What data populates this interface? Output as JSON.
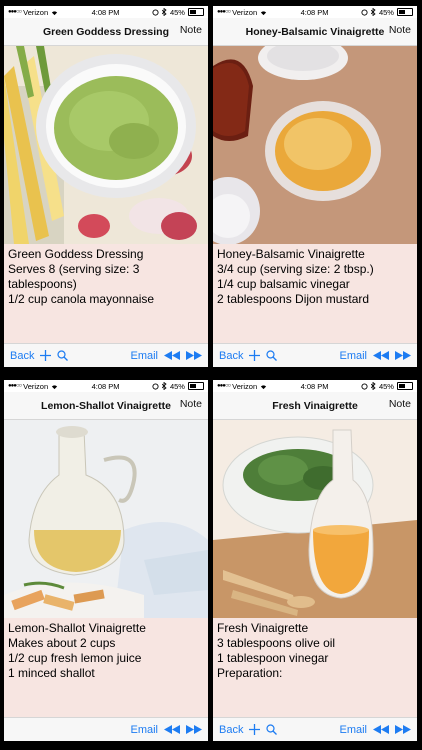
{
  "status_bar": {
    "carrier": "Verizon",
    "time": "4:08 PM",
    "battery": "45%"
  },
  "panels": [
    {
      "title": "Green Goddess Dressing",
      "note_label": "Note",
      "lines": [
        "Green Goddess Dressing",
        "",
        "Serves 8 (serving size: 3",
        "tablespoons)",
        "",
        "1/2 cup canola mayonnaise"
      ]
    },
    {
      "title": "Honey-Balsamic Vinaigrette",
      "note_label": "Note",
      "lines": [
        "Honey-Balsamic Vinaigrette",
        "",
        "3/4 cup (serving size: 2 tbsp.)",
        "",
        "1/4 cup balsamic vinegar",
        "2 tablespoons Dijon mustard"
      ]
    },
    {
      "title": "Lemon-Shallot Vinaigrette",
      "note_label": "Note",
      "lines": [
        "Lemon-Shallot Vinaigrette",
        "",
        "Makes about 2 cups",
        "",
        "1/2 cup fresh lemon juice",
        "1 minced shallot"
      ]
    },
    {
      "title": "Fresh Vinaigrette",
      "note_label": "Note",
      "lines": [
        "Fresh Vinaigrette",
        "",
        "3 tablespoons olive oil",
        "1 tablespoon vinegar",
        "",
        "Preparation:"
      ]
    }
  ],
  "toolbar": {
    "back_label": "Back",
    "email_label": "Email"
  },
  "colors": {
    "accent": "#1d7cf2",
    "content_bg": "#f7e5e1"
  },
  "icons": [
    "wifi-icon",
    "alarm-icon",
    "bluetooth-icon",
    "battery-icon",
    "plus-icon",
    "search-icon",
    "rewind-icon",
    "fast-forward-icon"
  ]
}
